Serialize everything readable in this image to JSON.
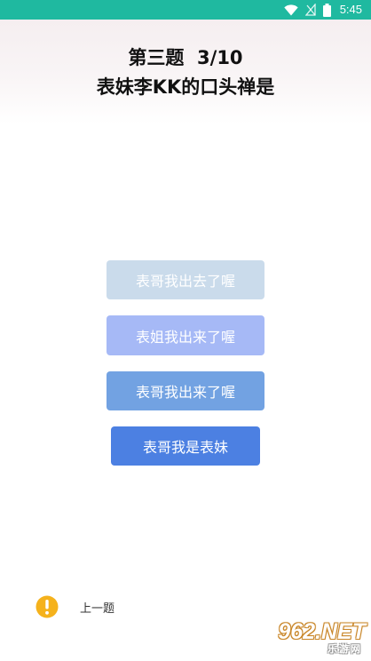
{
  "status_bar": {
    "time": "5:45",
    "icons": [
      "wifi-icon",
      "signal-icon",
      "battery-icon"
    ],
    "color": "#1fb9a0"
  },
  "question": {
    "number": "第三题  3/10",
    "text": "表妹李KK的口头禅是"
  },
  "options": [
    {
      "label": "表哥我出去了喔",
      "color": "#cadbeb"
    },
    {
      "label": "表姐我出来了喔",
      "color": "#a6b9f6"
    },
    {
      "label": "表哥我出来了喔",
      "color": "#72a2e2"
    },
    {
      "label": "表哥我是表妹",
      "color": "#4c80e2"
    }
  ],
  "footer": {
    "alert_icon": "exclamation-circle-icon",
    "alert_color": "#f5b21c",
    "prev_label": "上一题"
  },
  "watermark": {
    "brand": "962.NET",
    "subtitle": "乐游网"
  }
}
